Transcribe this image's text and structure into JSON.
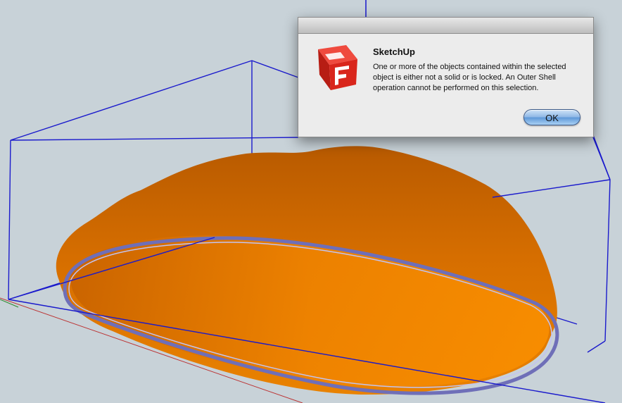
{
  "viewport": {
    "model_icon": "orange-solid-model",
    "bounding_box_icon": "blue-bounding-box",
    "axis_icon": "red-green-blue-axes",
    "colors": {
      "background": "#c8d2d8",
      "model": "#e57a00",
      "bounding_box": "#1a1acc"
    }
  },
  "dialog": {
    "title": "SketchUp",
    "message": "One or more of the objects contained within the selected object is either not a solid or is locked. An Outer Shell operation cannot be performed on this selection.",
    "ok_label": "OK",
    "app_icon": "sketchup-logo-icon",
    "accent": "#d9261c"
  }
}
